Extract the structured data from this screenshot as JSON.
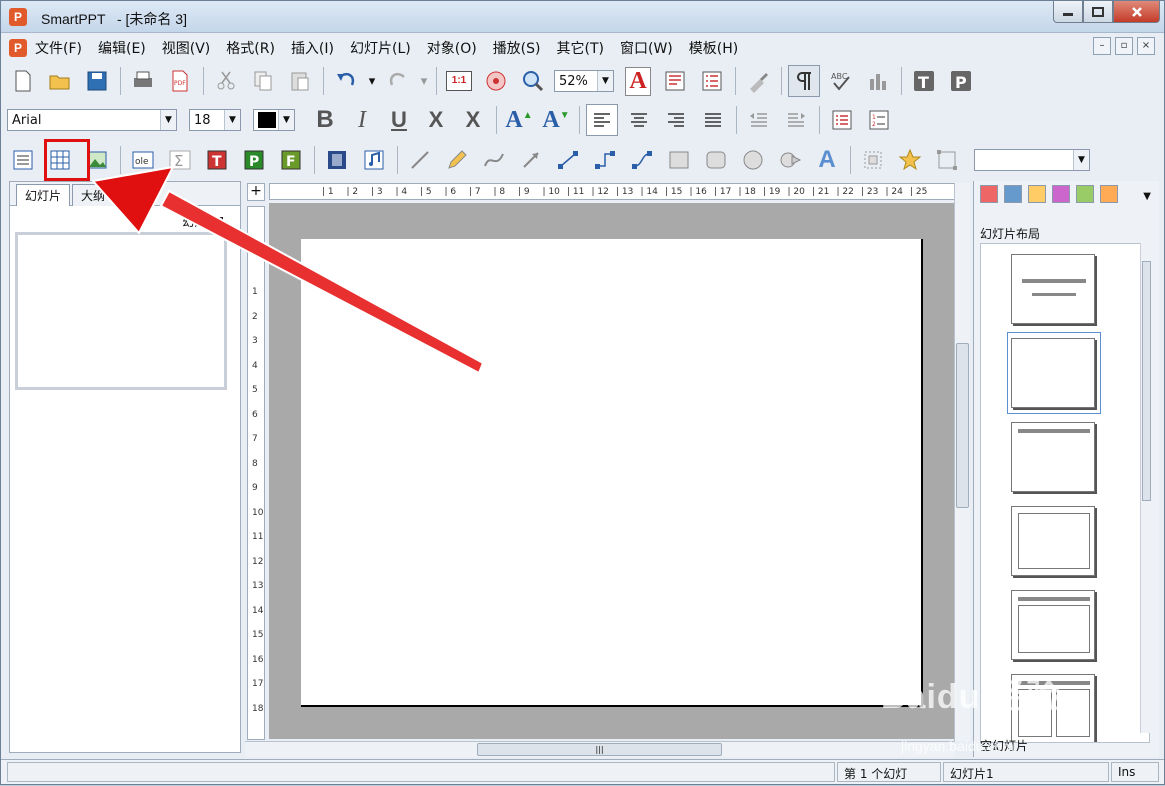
{
  "window": {
    "app_name": "SmartPPT",
    "doc_title": "   - [未命名 3]",
    "app_icon_letter": "P"
  },
  "menu": [
    "文件(F)",
    "编辑(E)",
    "视图(V)",
    "格式(R)",
    "插入(I)",
    "幻灯片(L)",
    "对象(O)",
    "播放(S)",
    "其它(T)",
    "窗口(W)",
    "模板(H)"
  ],
  "toolbar": {
    "zoom": "52%",
    "font_family": "Arial",
    "font_size": "18",
    "zoom_label_btn": "1:1"
  },
  "left_panel": {
    "tab_slides": "幻灯片",
    "tab_outline": "大纲",
    "slide_label": "幻灯片1"
  },
  "ruler_h": [
    "1",
    "2",
    "3",
    "4",
    "5",
    "6",
    "7",
    "8",
    "9",
    "10",
    "11",
    "12",
    "13",
    "14",
    "15",
    "16",
    "17",
    "18",
    "19",
    "20",
    "21",
    "22",
    "23",
    "24",
    "25"
  ],
  "ruler_v": [
    "1",
    "2",
    "3",
    "4",
    "5",
    "6",
    "7",
    "8",
    "9",
    "10",
    "11",
    "12",
    "13",
    "14",
    "15",
    "16",
    "17",
    "18"
  ],
  "right_panel": {
    "title": "幻灯片布局",
    "bottom_label": "空幻灯片"
  },
  "status": {
    "slide_index": "第 1 个幻灯",
    "slide_name": "幻灯片1",
    "mode": "Ins"
  },
  "watermark": {
    "main": "Baidu 经验",
    "sub": "jingyan.baidu.com"
  },
  "colors": {
    "accent_red": "#e01010",
    "app_orange": "#e05a2b"
  }
}
